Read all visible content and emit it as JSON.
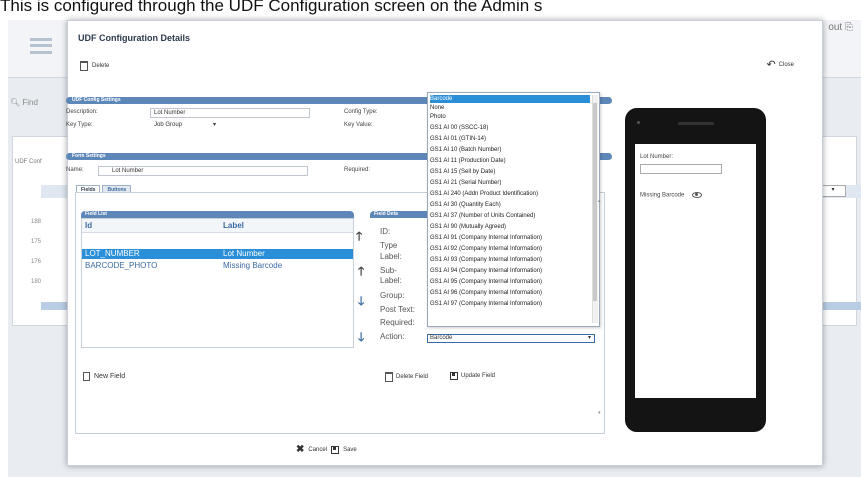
{
  "caption": "This is configured through the UDF Configuration screen on the Admin s",
  "background": {
    "signout": "out",
    "find": "Find",
    "udf_label": "UDF Conf",
    "rows": [
      "188",
      "175",
      "176",
      "180"
    ]
  },
  "modal": {
    "title": "UDF Configuration Details",
    "delete_label": "Delete",
    "close_label": "Close",
    "udf_config": {
      "section": "UDF Config Settings",
      "description_label": "Description:",
      "description_value": "Lot Number",
      "keytype_label": "Key Type:",
      "keytype_value": "Job Group",
      "configtype_label": "Config Type:",
      "keyvalue_label": "Key Value:"
    },
    "form": {
      "section": "Form Settings",
      "name_label": "Name:",
      "name_value": "Lot Number",
      "required_label": "Required:"
    },
    "tabs": [
      "Fields",
      "Buttons"
    ],
    "field_list": {
      "section": "Field List",
      "col_id": "Id",
      "col_label": "Label",
      "rows": [
        {
          "id": "LOT_NUMBER",
          "label": "Lot Number"
        },
        {
          "id": "BARCODE_PHOTO",
          "label": "Missing Barcode"
        }
      ]
    },
    "field_detail": {
      "section": "Field Deta",
      "labels": [
        "ID:",
        "Type",
        "Label:",
        "Sub-",
        "Label:",
        "Group:",
        "Post Text:",
        "Required:",
        "Action:"
      ],
      "action_value": "Barcode"
    },
    "dropdown_options": [
      "Barcode",
      "None",
      "Photo",
      "GS1 AI 00 (SSCC-18)",
      "GS1 AI 01 (GTIN-14)",
      "GS1 AI 10 (Batch Number)",
      "GS1 AI 11 (Production Date)",
      "GS1 AI 15 (Sell by Date)",
      "GS1 AI 21 (Serial Number)",
      "GS1 AI 240 (Addn Product Identification)",
      "GS1 AI 30 (Quantity Each)",
      "GS1 AI 37 (Number of Units Contained)",
      "GS1 AI 90 (Mutually Agreed)",
      "GS1 AI 91 (Company Internal Information)",
      "GS1 AI 92 (Company Internal Information)",
      "GS1 AI 93 (Company Internal Information)",
      "GS1 AI 94 (Company Internal Information)",
      "GS1 AI 95 (Company Internal Information)",
      "GS1 AI 96 (Company Internal Information)",
      "GS1 AI 97 (Company Internal Information)"
    ],
    "new_field_label": "New Field",
    "delete_field_label": "Delete Field",
    "update_field_label": "Update Field",
    "cancel_label": "Cancel",
    "save_label": "Save"
  },
  "phone": {
    "lot_number_label": "Lot Number:",
    "missing_barcode_label": "Missing Barcode"
  }
}
